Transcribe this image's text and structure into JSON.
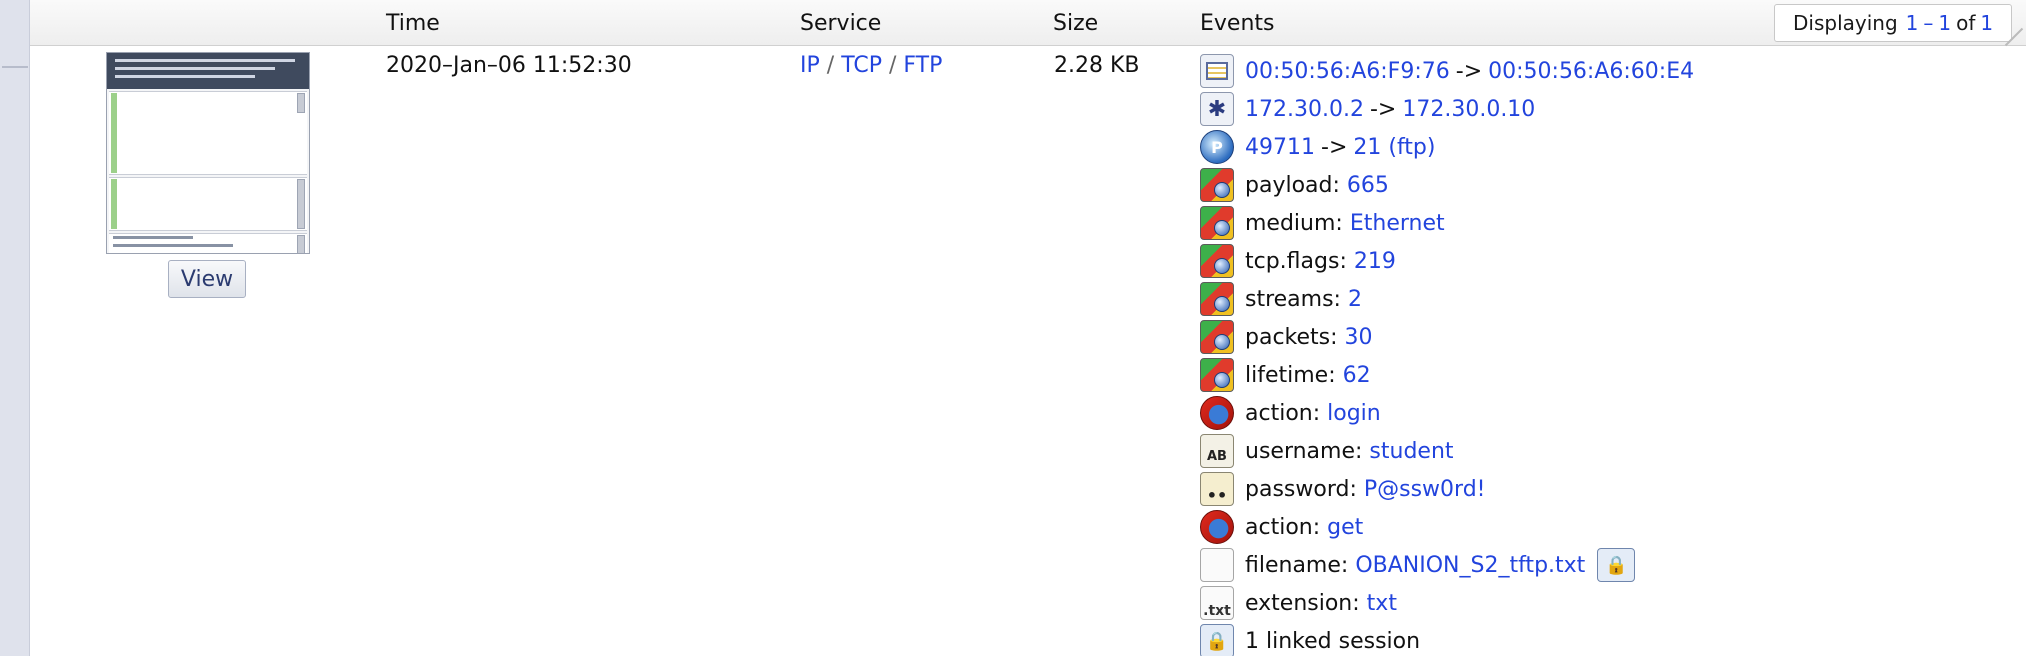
{
  "header": {
    "time": "Time",
    "service": "Service",
    "size": "Size",
    "events": "Events"
  },
  "pager": {
    "prefix": "Displaying",
    "from": "1",
    "sep": "–",
    "to": "1",
    "of": "of",
    "total": "1"
  },
  "row": {
    "thumbnail_button": "View",
    "time": "2020–Jan–06 11:52:30",
    "service": {
      "ip": "IP",
      "tcp": "TCP",
      "ftp": "FTP",
      "separator": "/"
    },
    "size": "2.28 KB"
  },
  "events": {
    "eth": {
      "icon": "ethernet-icon",
      "src": "00:50:56:A6:F9:76",
      "arrow": "->",
      "dst": "00:50:56:A6:60:E4"
    },
    "ip": {
      "icon": "ip-icon",
      "src": "172.30.0.2",
      "arrow": "->",
      "dst": "172.30.0.10"
    },
    "port": {
      "icon": "port-icon",
      "src": "49711",
      "arrow": "->",
      "dst": "21 (ftp)"
    },
    "payload": {
      "icon": "meta-icon",
      "label": "payload:",
      "value": "665"
    },
    "medium": {
      "icon": "meta-icon",
      "label": "medium:",
      "value": "Ethernet"
    },
    "tcp_flags": {
      "icon": "meta-icon",
      "label": "tcp.flags:",
      "value": "219"
    },
    "streams": {
      "icon": "meta-icon",
      "label": "streams:",
      "value": "2"
    },
    "packets": {
      "icon": "meta-icon",
      "label": "packets:",
      "value": "30"
    },
    "lifetime": {
      "icon": "meta-icon",
      "label": "lifetime:",
      "value": "62"
    },
    "action_login": {
      "icon": "action-icon",
      "label": "action:",
      "value": "login"
    },
    "username": {
      "icon": "username-icon",
      "label": "username:",
      "value": "student"
    },
    "password": {
      "icon": "password-icon",
      "label": "password:",
      "value": "P@ssw0rd!"
    },
    "action_get": {
      "icon": "action-icon",
      "label": "action:",
      "value": "get"
    },
    "filename": {
      "icon": "file-icon",
      "label": "filename:",
      "value": "OBANION_S2_tftp.txt"
    },
    "extension": {
      "icon": "extension-icon",
      "label": "extension:",
      "value": "txt"
    },
    "linked": {
      "icon": "linked-session-icon",
      "label": "1 linked session"
    }
  },
  "colors": {
    "link": "#2244dd",
    "header_bg": "#eeeeee",
    "rail": "#dfe2ec"
  }
}
